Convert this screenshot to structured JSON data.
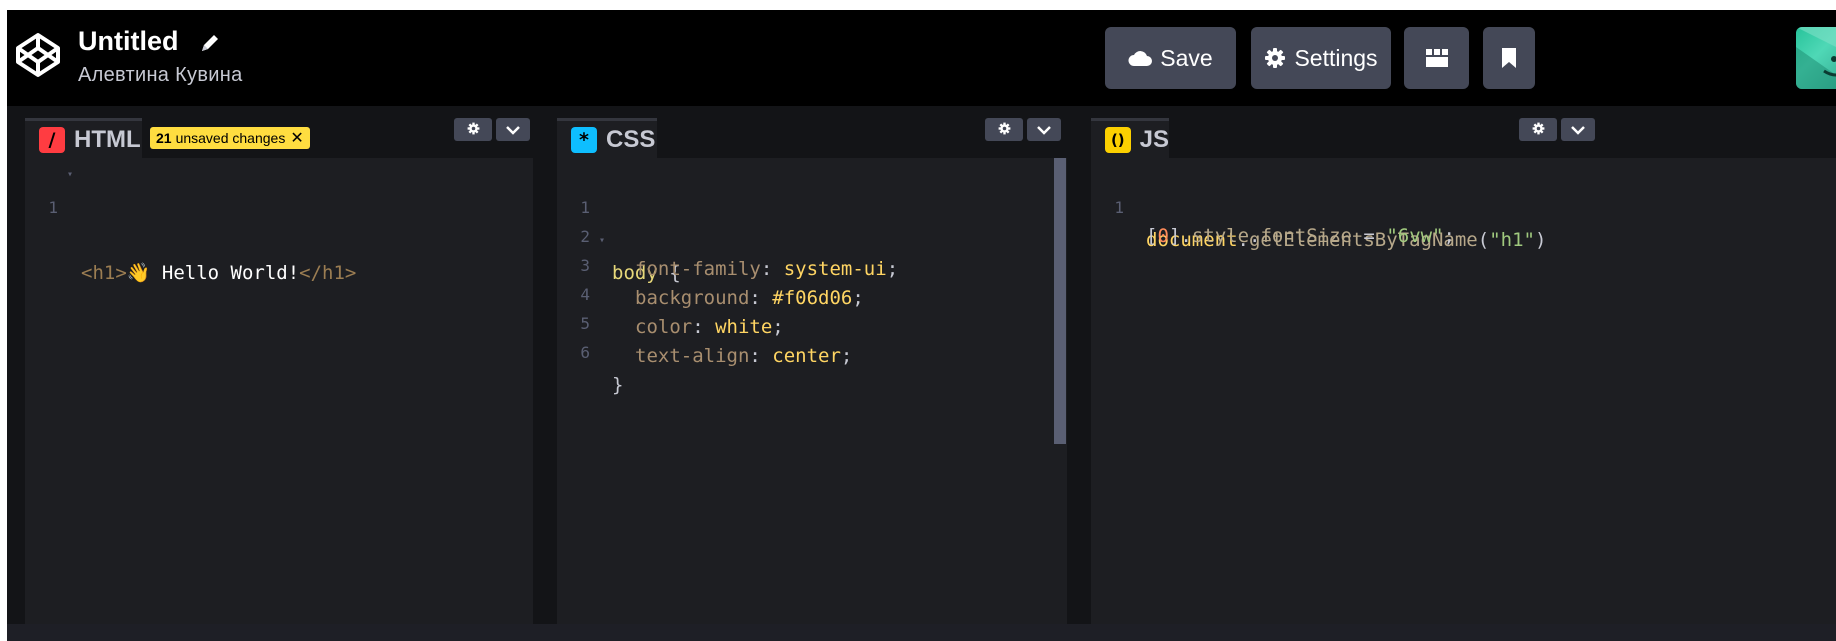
{
  "header": {
    "title": "Untitled",
    "author": "Алевтина Кувина",
    "buttons": {
      "save": "Save",
      "settings": "Settings"
    }
  },
  "panels": {
    "html": {
      "label": "HTML",
      "unsaved_count": "21",
      "unsaved_text": "unsaved changes",
      "unsaved_close": "✕",
      "lines": [
        {
          "num": "1",
          "open_tag": "<h1>",
          "emoji": "👋",
          "text": " Hello World!",
          "close_tag": "</h1>"
        }
      ]
    },
    "css": {
      "label": "CSS",
      "lines": [
        {
          "num": "1",
          "selector": "body",
          "brace": " {"
        },
        {
          "num": "2",
          "prop": "font-family",
          "colon": ": ",
          "value": "system-ui",
          "semi": ";"
        },
        {
          "num": "3",
          "prop": "background",
          "colon": ": ",
          "value": "#f06d06",
          "semi": ";"
        },
        {
          "num": "4",
          "prop": "color",
          "colon": ": ",
          "value": "white",
          "semi": ";"
        },
        {
          "num": "5",
          "prop": "text-align",
          "colon": ": ",
          "value": "center",
          "semi": ";"
        },
        {
          "num": "6",
          "brace": "}"
        }
      ]
    },
    "js": {
      "label": "JS",
      "line1": {
        "num": "1",
        "obj": "document",
        "dot": ".",
        "method": "getElementsByTagName",
        "open": "(",
        "arg": "\"h1\"",
        "close": ")"
      },
      "line1_wrap": {
        "open": "[",
        "index": "0",
        "close": "]",
        "dot1": ".",
        "style": "style",
        "dot2": ".",
        "prop": "fontSize",
        "eq": " = ",
        "value": "\"6vw\"",
        "semi": ";"
      }
    }
  },
  "icons": {
    "logo": "codepen-logo-icon",
    "edit": "pencil-icon",
    "save": "cloud-icon",
    "settings": "gear-icon",
    "layout": "layout-icon",
    "bookmark": "bookmark-icon",
    "panel_settings": "gear-icon",
    "panel_collapse": "chevron-down-icon"
  },
  "colors": {
    "html_icon": "#ff3c41",
    "css_icon": "#0ebeff",
    "js_icon": "#fcd000",
    "badge": "#ffdd40",
    "button": "#444857"
  }
}
